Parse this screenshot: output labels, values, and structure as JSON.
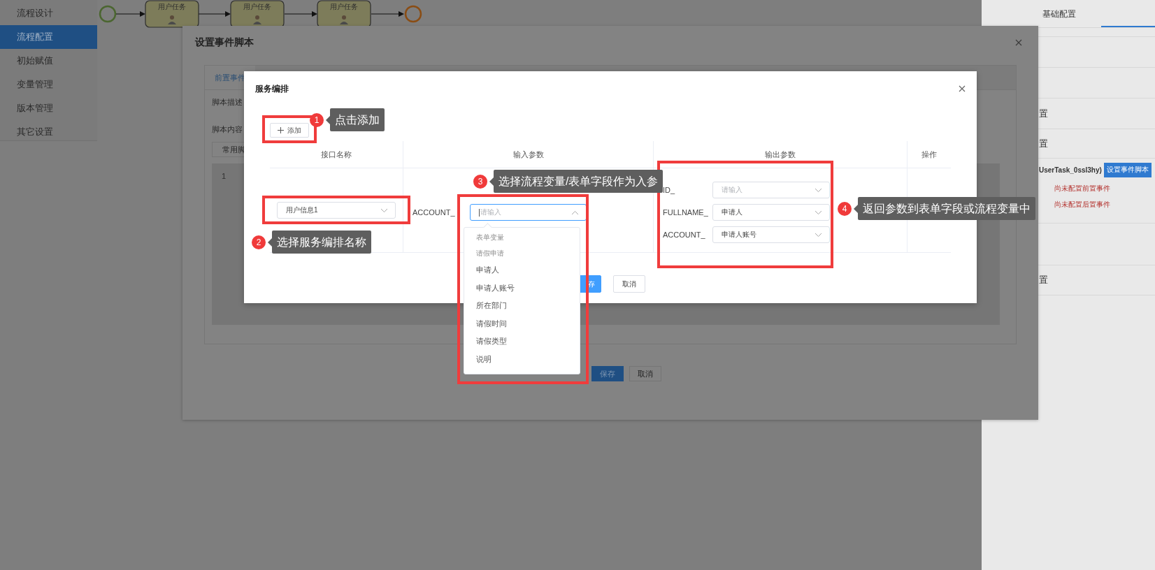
{
  "flow_diagram": {
    "tasks": [
      {
        "label": "用户任务"
      },
      {
        "label": "用户任务"
      },
      {
        "label": "用户任务"
      }
    ]
  },
  "sidebar": {
    "items": [
      {
        "label": "流程设计",
        "selected": false
      },
      {
        "label": "流程配置",
        "selected": true
      },
      {
        "label": "初始赋值",
        "selected": false
      },
      {
        "label": "变量管理",
        "selected": false
      },
      {
        "label": "版本管理",
        "selected": false
      },
      {
        "label": "其它设置",
        "selected": false
      }
    ]
  },
  "right_panel": {
    "tabs": [
      {
        "label": "基础配置",
        "selected": false
      },
      {
        "selected": true
      }
    ],
    "row_fragments": [
      "置",
      "置"
    ],
    "task_id": "UserTask_0ssl3hy)",
    "script_button": "设置事件脚本",
    "warnings": [
      "尚未配置前置事件",
      "尚未配置后置事件"
    ],
    "last_fragment": "置"
  },
  "event_script_dialog": {
    "title": "设置事件脚本",
    "tab": "前置事件",
    "fields": [
      "脚本描述",
      "脚本内容"
    ],
    "script_button": "常用脚",
    "line_numbers": [
      "1"
    ],
    "buttons": [
      {
        "label": "保存",
        "kind": "primary"
      },
      {
        "label": "取消",
        "kind": "default"
      }
    ]
  },
  "service_dialog": {
    "title": "服务编排",
    "add_button": "添加",
    "columns": [
      "接口名称",
      "输入参数",
      "输出参数",
      "操作"
    ],
    "row": {
      "service": "用户信息1",
      "inputs": [
        {
          "name": "ACCOUNT_",
          "placeholder": "请输入"
        }
      ],
      "outputs": [
        {
          "name": "ID_",
          "placeholder": "请输入"
        },
        {
          "name": "FULLNAME_",
          "value": "申请人"
        },
        {
          "name": "ACCOUNT_",
          "value": "申请人账号"
        }
      ]
    },
    "buttons": [
      {
        "label": "存",
        "kind": "primary"
      },
      {
        "label": "取消",
        "kind": "default"
      }
    ]
  },
  "dropdown": {
    "items": [
      {
        "label": "表单变量",
        "kind": "group"
      },
      {
        "label": "请假申请",
        "kind": "group"
      },
      {
        "label": "申请人",
        "kind": "option"
      },
      {
        "label": "申请人账号",
        "kind": "option"
      },
      {
        "label": "所在部门",
        "kind": "option"
      },
      {
        "label": "请假时间",
        "kind": "option"
      },
      {
        "label": "请假类型",
        "kind": "option"
      },
      {
        "label": "说明",
        "kind": "option"
      }
    ]
  },
  "annotations": [
    {
      "number": "1",
      "text": "点击添加"
    },
    {
      "number": "2",
      "text": "选择服务编排名称"
    },
    {
      "number": "3",
      "text": "选择流程变量/表单字段作为入参"
    },
    {
      "number": "4",
      "text": "返回参数到表单字段或流程变量中"
    }
  ]
}
